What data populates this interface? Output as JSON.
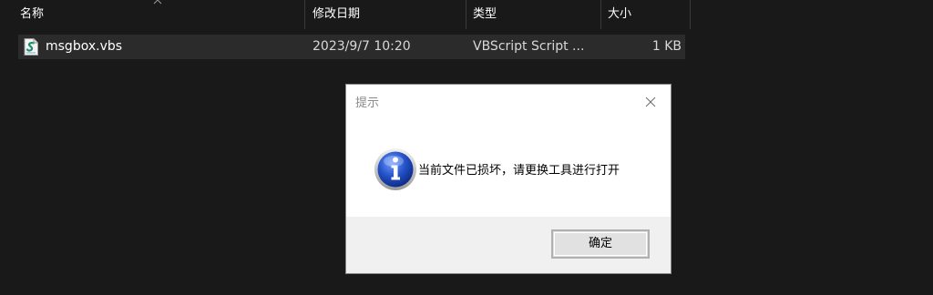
{
  "explorer": {
    "columns": {
      "name": "名称",
      "modified": "修改日期",
      "type": "类型",
      "size": "大小"
    },
    "sort_indicator": "up-arrow",
    "files": [
      {
        "name": "msgbox.vbs",
        "icon": "vbs-script-icon",
        "modified": "2023/9/7 10:20",
        "type": "VBScript Script ...",
        "size": "1 KB"
      }
    ]
  },
  "dialog": {
    "title": "提示",
    "icon": "info-icon",
    "message": "当前文件已损坏，请更换工具进行打开",
    "ok_label": "确定"
  },
  "colors": {
    "background": "#191919",
    "selected_row": "#2b2b2b",
    "dialog_bg": "#ffffff",
    "dialog_footer": "#f0f0f0",
    "info_blue": "#1f4fbf"
  }
}
